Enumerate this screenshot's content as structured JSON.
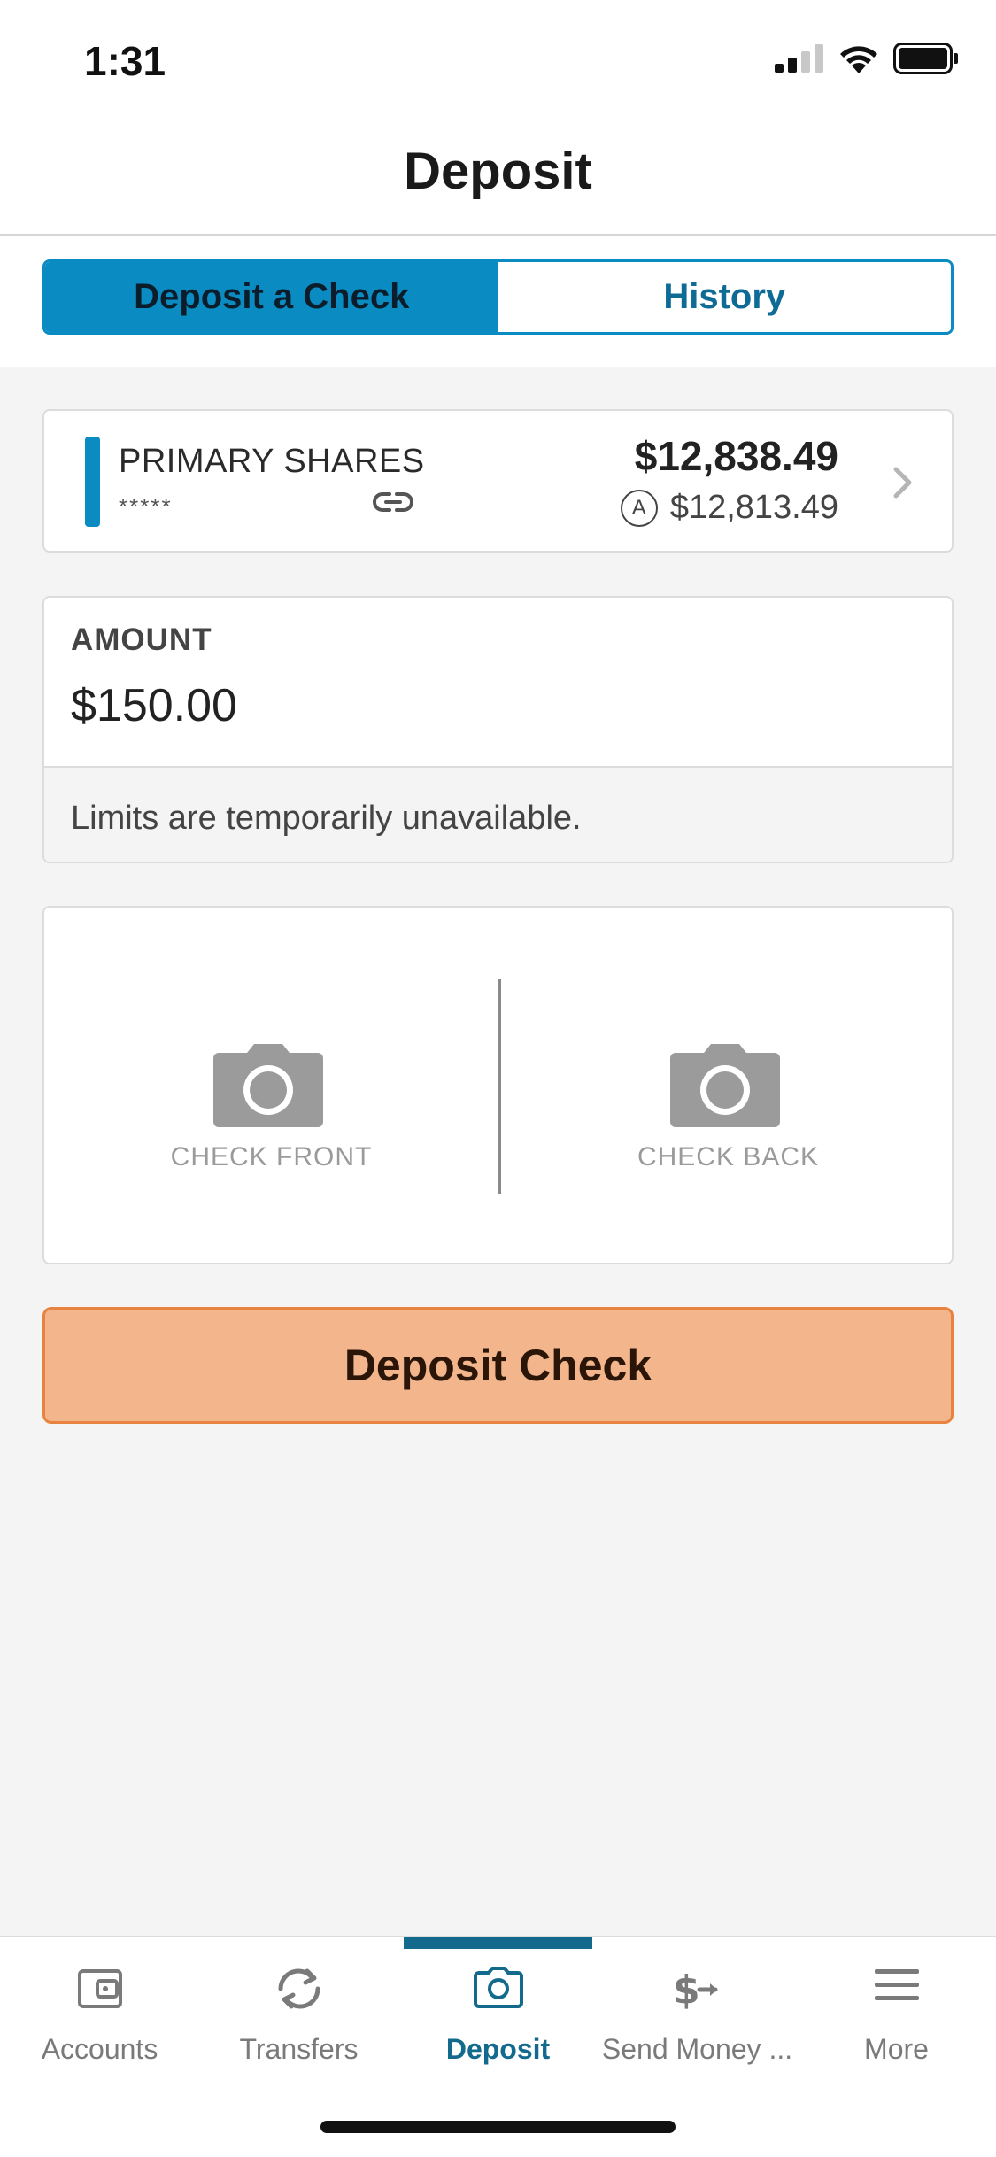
{
  "status": {
    "time": "1:31"
  },
  "header": {
    "title": "Deposit"
  },
  "segments": {
    "deposit_label": "Deposit a Check",
    "history_label": "History"
  },
  "account": {
    "name": "PRIMARY SHARES",
    "number_masked": "*****",
    "balance": "$12,838.49",
    "available_badge": "A",
    "available_balance": "$12,813.49"
  },
  "amount": {
    "label": "AMOUNT",
    "value": "$150.00",
    "limits_text": "Limits are temporarily unavailable."
  },
  "photos": {
    "front_label": "CHECK FRONT",
    "back_label": "CHECK BACK"
  },
  "deposit_button": {
    "label": "Deposit Check"
  },
  "tabbar": {
    "items": [
      {
        "label": "Accounts",
        "icon": "wallet-icon"
      },
      {
        "label": "Transfers",
        "icon": "transfer-arrows-icon"
      },
      {
        "label": "Deposit",
        "icon": "camera-icon",
        "active": true
      },
      {
        "label": "Send Money ...",
        "icon": "dollar-send-icon"
      },
      {
        "label": "More",
        "icon": "hamburger-menu-icon"
      }
    ]
  },
  "colors": {
    "accent": "#0a8cc2",
    "tab_active": "#136a8c",
    "deposit_button_bg": "#f2b58c",
    "deposit_button_border": "#e8833f"
  }
}
